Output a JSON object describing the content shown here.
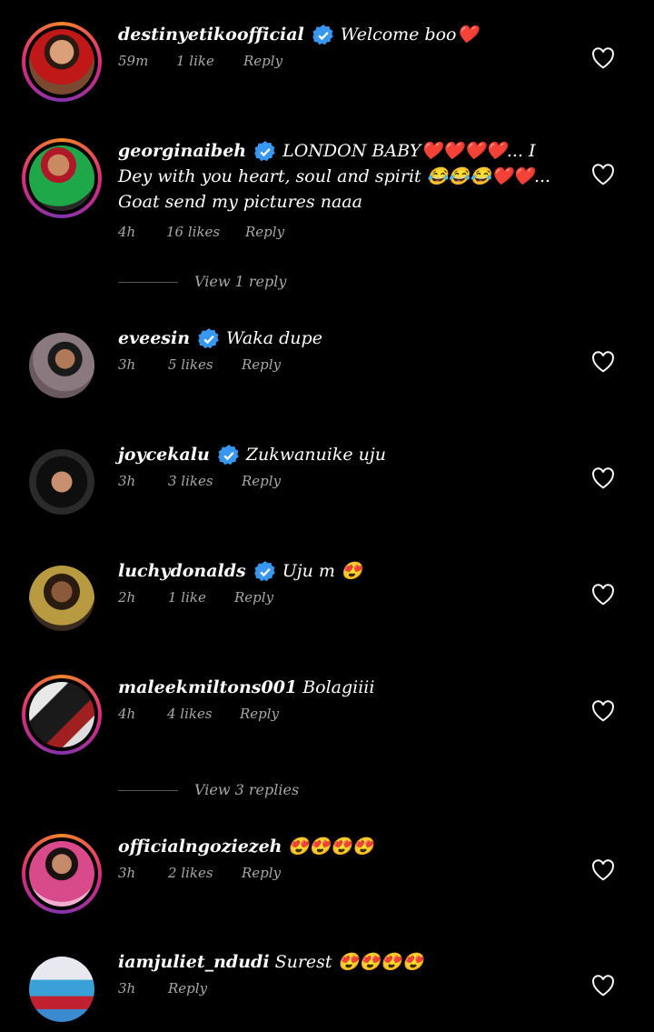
{
  "colors": {
    "verified": "#3897f0",
    "heart_red": "#e0245e",
    "meta": "#a8a8a8"
  },
  "comments": [
    {
      "username": "destinyetikoofficial",
      "verified": true,
      "text": "Welcome boo❤️",
      "time": "59m",
      "likes": "1 like",
      "reply": "Reply",
      "ring": true
    },
    {
      "username": "georginaibeh",
      "verified": true,
      "text": "LONDON BABY❤️❤️❤️❤️... I Dey with you heart, soul and spirit 😂😂😂❤️❤️... Goat send my pictures naaa",
      "time": "4h",
      "likes": "16 likes",
      "reply": "Reply",
      "ring": true
    },
    {
      "username": "eveesin",
      "verified": true,
      "text": "Waka dupe",
      "time": "3h",
      "likes": "5 likes",
      "reply": "Reply",
      "ring": false
    },
    {
      "username": "joycekalu",
      "verified": true,
      "text": "Zukwanuike uju",
      "time": "3h",
      "likes": "3 likes",
      "reply": "Reply",
      "ring": false
    },
    {
      "username": "luchydonalds",
      "verified": true,
      "text": "Uju m 😍",
      "time": "2h",
      "likes": "1 like",
      "reply": "Reply",
      "ring": false
    },
    {
      "username": "maleekmiltons001",
      "verified": false,
      "text": "Bolagiiii",
      "time": "4h",
      "likes": "4 likes",
      "reply": "Reply",
      "ring": true
    },
    {
      "username": "officialngoziezeh",
      "verified": false,
      "text": "😍😍😍😍",
      "time": "3h",
      "likes": "2 likes",
      "reply": "Reply",
      "ring": true
    },
    {
      "username": "iamjuliet_ndudi",
      "verified": false,
      "text": "Surest 😍😍😍😍",
      "time": "3h",
      "likes": "",
      "reply": "Reply",
      "ring": false
    }
  ],
  "view_replies": [
    {
      "label": "View 1 reply"
    },
    {
      "label": "View 3 replies"
    }
  ]
}
